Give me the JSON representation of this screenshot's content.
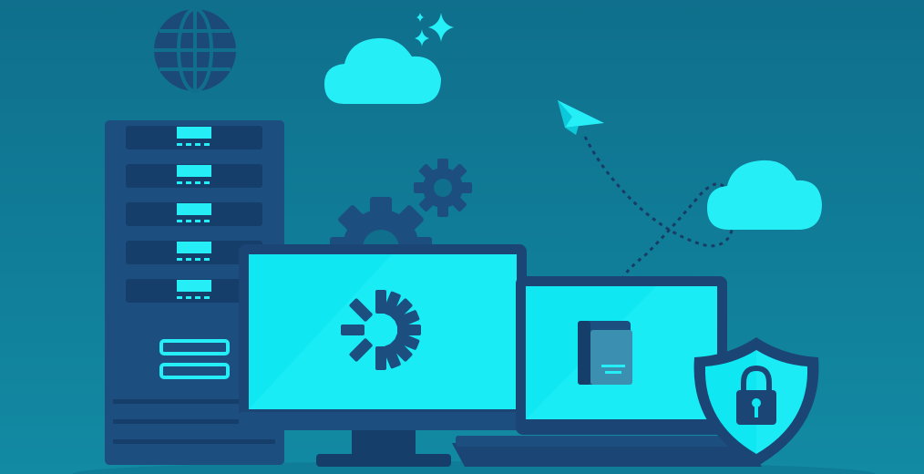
{
  "colors": {
    "background_top": "#0f6f8c",
    "background_bottom": "#11889f",
    "dark_navy": "#163e6b",
    "navy": "#1d4e80",
    "navy_panel": "#1b4574",
    "cyan": "#0fe7f2",
    "cyan_light": "#25f0f7",
    "cyan_dim": "#0bd6e6"
  },
  "icons": {
    "globe": "globe-icon",
    "cloud": "cloud-icon",
    "sparkle": "sparkle-icon",
    "paper_plane": "paper-plane-icon",
    "gear": "gear-icon",
    "server": "server-rack-icon",
    "monitor": "desktop-monitor-icon",
    "laptop": "laptop-icon",
    "book": "book-icon",
    "shield": "security-shield-icon",
    "padlock": "padlock-icon",
    "logo_burst": "burst-logo-icon"
  }
}
